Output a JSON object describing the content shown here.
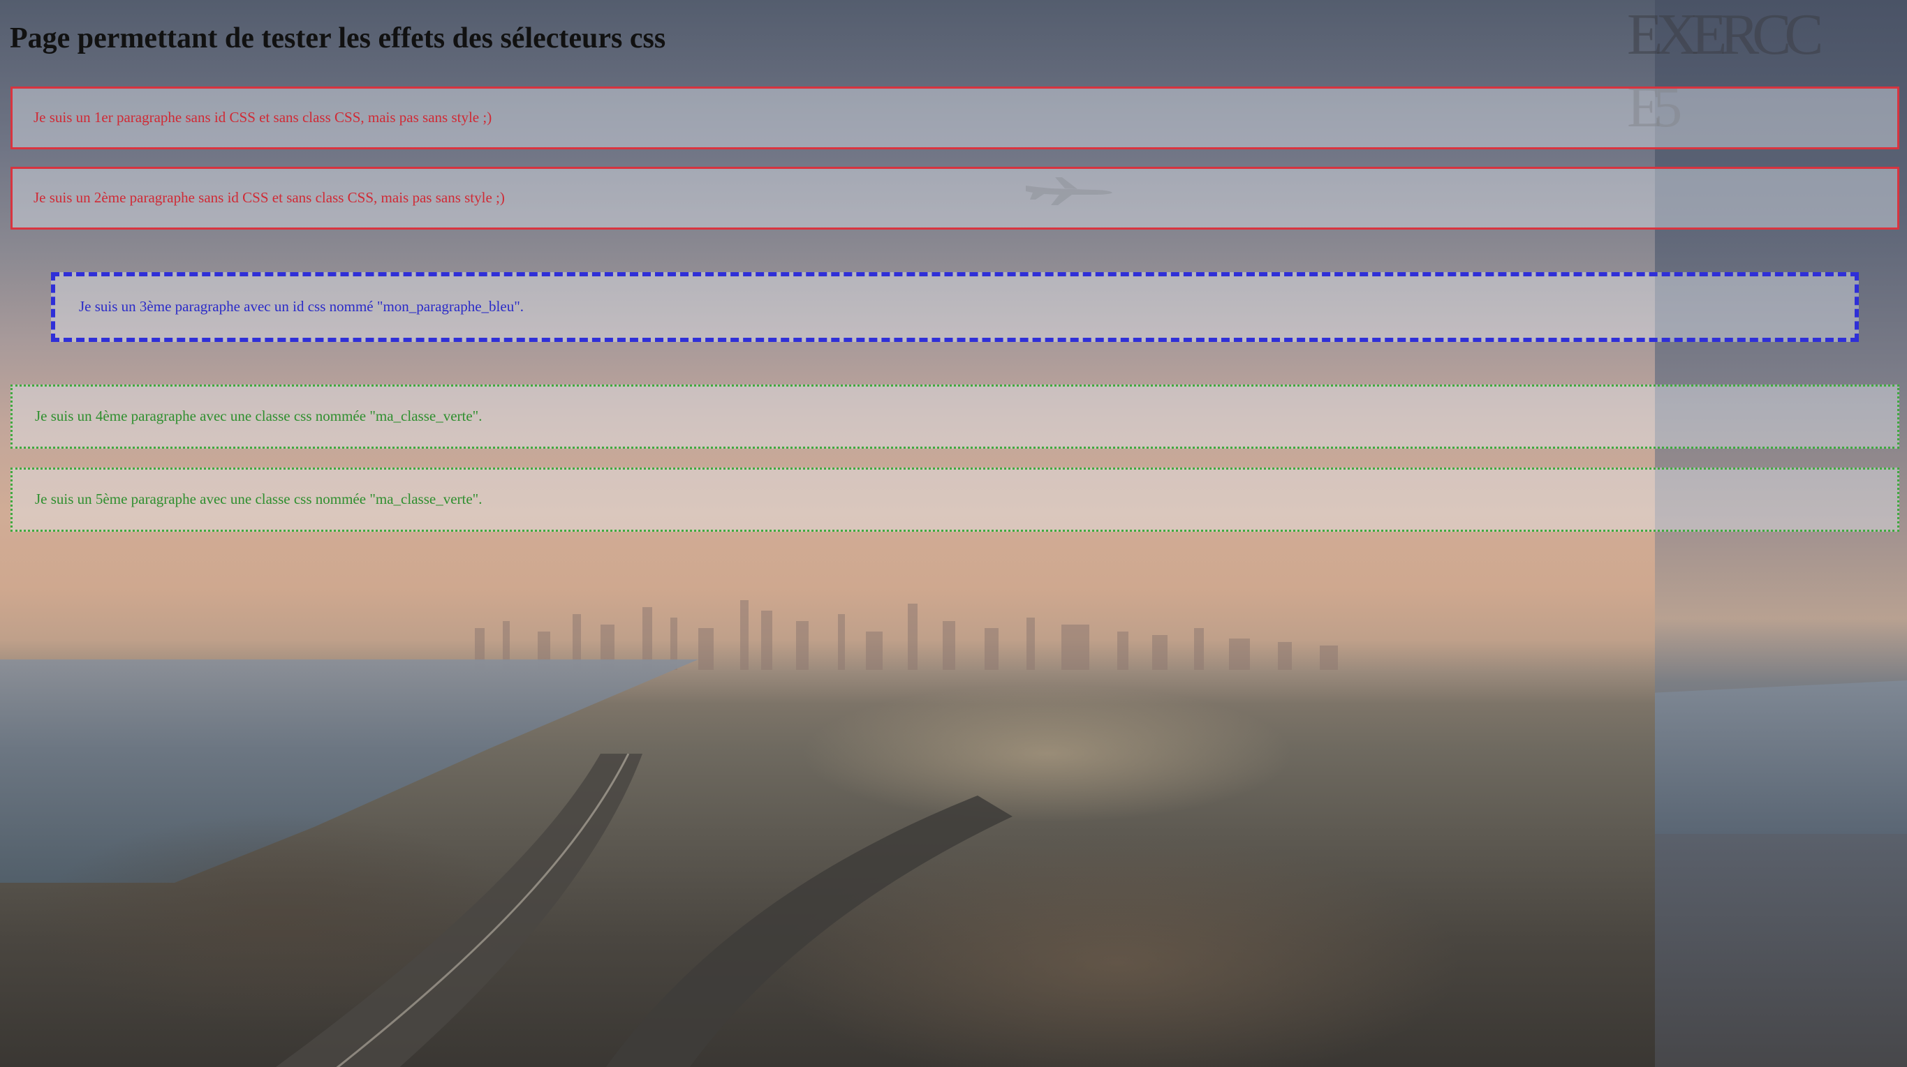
{
  "page": {
    "title": "Page permettant de tester les effets des sélecteurs css"
  },
  "paragraphs": [
    {
      "text": "Je suis un 1er paragraphe sans id CSS et sans class CSS, mais pas sans style ;)",
      "style": "red-solid",
      "color": "#d02a35"
    },
    {
      "text": "Je suis un 2ème paragraphe sans id CSS et sans class CSS, mais pas sans style ;)",
      "style": "red-solid",
      "color": "#d02a35"
    },
    {
      "text": "Je suis un 3ème paragraphe avec un id css nommé \"mon_paragraphe_bleu\".",
      "style": "blue-dashed",
      "color": "#2b2bc8"
    },
    {
      "text": "Je suis un 4ème paragraphe avec une classe css nommée \"ma_classe_verte\".",
      "style": "green-dotted",
      "color": "#2f8f2f"
    },
    {
      "text": "Je suis un 5ème paragraphe avec une classe css nommée \"ma_classe_verte\".",
      "style": "green-dotted",
      "color": "#2f8f2f"
    }
  ],
  "decorations": {
    "watermark_line1": "EXERCC",
    "watermark_line2": "E5",
    "background": "aerial-city-photo",
    "airplane_icon": "airplane-icon"
  }
}
